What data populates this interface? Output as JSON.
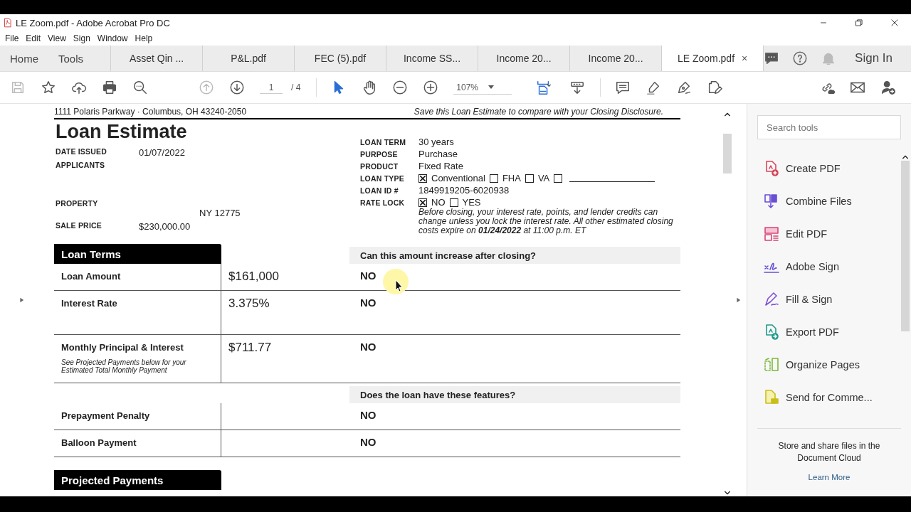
{
  "window": {
    "title": "LE Zoom.pdf - Adobe Acrobat Pro DC"
  },
  "menu": [
    "File",
    "Edit",
    "View",
    "Sign",
    "Window",
    "Help"
  ],
  "nav": [
    "Home",
    "Tools"
  ],
  "tabs": [
    {
      "label": "Asset Qin ...",
      "selected": false
    },
    {
      "label": "P&L.pdf",
      "selected": false
    },
    {
      "label": "FEC (5).pdf",
      "selected": false
    },
    {
      "label": "Income SS...",
      "selected": false
    },
    {
      "label": "Income 20...",
      "selected": false
    },
    {
      "label": "Income 20...",
      "selected": false
    },
    {
      "label": "LE Zoom.pdf",
      "selected": true,
      "close": "×"
    }
  ],
  "sign_in": "Sign In",
  "toolbar": {
    "page": "1",
    "page_count": "/ 4",
    "zoom": "107%"
  },
  "document": {
    "address": "1111 Polaris Parkway · Columbus, OH 43240-2050",
    "save_note": "Save this Loan Estimate to compare with your Closing Disclosure.",
    "title": "Loan Estimate",
    "left_fields": [
      {
        "label": "DATE ISSUED",
        "value": "01/07/2022"
      },
      {
        "label": "APPLICANTS"
      },
      {
        "label": "PROPERTY",
        "value": "NY 12775"
      },
      {
        "label": "SALE PRICE",
        "value": "$230,000.00"
      }
    ],
    "right_fields": [
      {
        "label": "LOAN TERM",
        "kind": "text",
        "value": "30 years"
      },
      {
        "label": "PURPOSE",
        "kind": "text",
        "value": "Purchase"
      },
      {
        "label": "PRODUCT",
        "kind": "text",
        "value": "Fixed Rate"
      },
      {
        "label": "LOAN TYPE",
        "kind": "options",
        "options": [
          {
            "label": "Conventional",
            "checked": true
          },
          {
            "label": "FHA",
            "checked": false
          },
          {
            "label": "VA",
            "checked": false
          },
          {
            "checked": false,
            "kind": "line"
          }
        ]
      },
      {
        "label": "LOAN ID #",
        "kind": "text",
        "value": "1849919205-6020938"
      },
      {
        "label": "RATE LOCK",
        "kind": "options",
        "options": [
          {
            "label": "NO",
            "checked": true
          },
          {
            "label": "YES",
            "checked": false
          }
        ]
      }
    ],
    "rate_lock_note": "Before closing, your interest rate, points, and lender credits can change unless you lock the interest rate. All other estimated closing costs expire on **01/24/2022** at 11:00 p.m. ET",
    "sections": [
      {
        "title": "Loan Terms",
        "question": "Can this amount increase after closing?",
        "rows": [
          {
            "label": "Loan Amount",
            "value": "$161,000",
            "answer": "NO"
          },
          {
            "label": "Interest Rate",
            "value": "3.375%",
            "answer": "NO"
          },
          {
            "label": "Monthly Principal & Interest",
            "note": "See Projected Payments below for your Estimated Total Monthly Payment",
            "value": "$711.77",
            "answer": "NO"
          }
        ]
      },
      {
        "question": "Does the loan have these features?",
        "rows": [
          {
            "label": "Prepayment Penalty",
            "answer": "NO"
          },
          {
            "label": "Balloon Payment",
            "answer": "NO"
          }
        ]
      },
      {
        "title": "Projected Payments"
      }
    ]
  },
  "tools_panel": {
    "search": {
      "placeholder": "Search tools"
    },
    "tools": [
      "Create PDF",
      "Combine Files",
      "Edit PDF",
      "Adobe Sign",
      "Fill & Sign",
      "Export PDF",
      "Organize Pages",
      "Send for Comme..."
    ],
    "promo": "Store and share files in the Document Cloud",
    "link": "Learn More"
  }
}
